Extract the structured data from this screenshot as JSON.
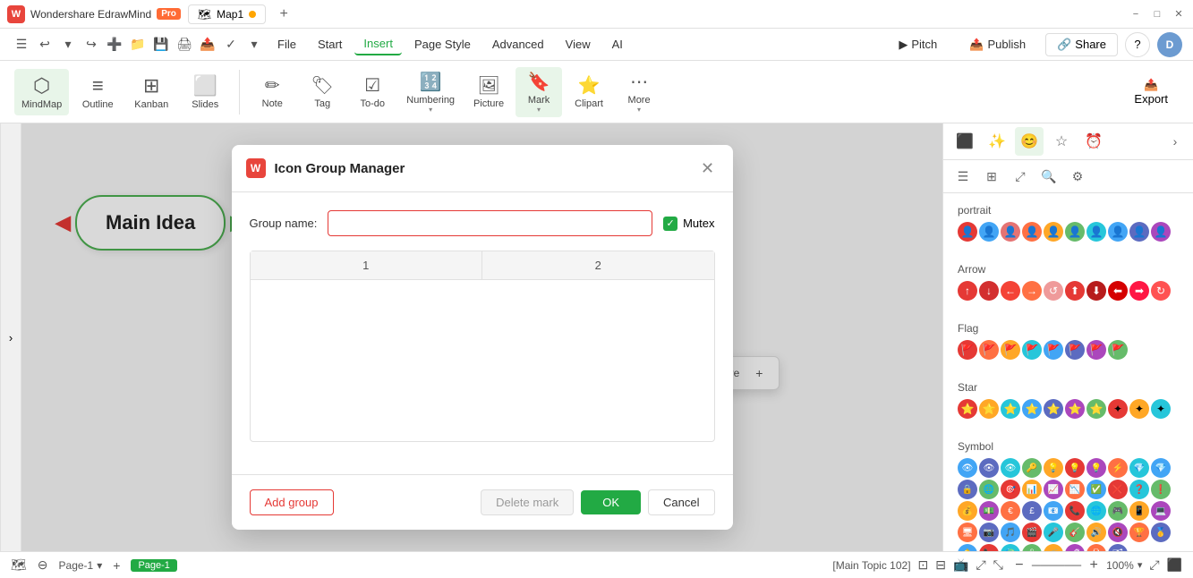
{
  "app": {
    "name": "Wondershare EdrawMind",
    "badge": "Pro",
    "tab": "Map1",
    "user_initial": "D"
  },
  "titlebar": {
    "minimize": "−",
    "maximize": "□",
    "close": "✕"
  },
  "quickaccess": {
    "undo": "↩",
    "redo": "↪"
  },
  "menu": {
    "items": [
      "File",
      "Start",
      "Insert",
      "Page Style",
      "Advanced",
      "View",
      "AI"
    ],
    "active": "Insert",
    "right": {
      "pitch": "Pitch",
      "publish": "Publish",
      "share": "Share",
      "help": "?",
      "user": "D"
    }
  },
  "toolbar": {
    "left_items": [
      {
        "id": "mindmap",
        "icon": "⬡",
        "label": "MindMap"
      },
      {
        "id": "outline",
        "icon": "≡",
        "label": "Outline"
      },
      {
        "id": "kanban",
        "icon": "⊞",
        "label": "Kanban"
      },
      {
        "id": "slides",
        "icon": "⬜",
        "label": "Slides"
      }
    ],
    "right_items": [
      {
        "id": "note",
        "icon": "✏",
        "label": "Note"
      },
      {
        "id": "tag",
        "icon": "🏷",
        "label": "Tag"
      },
      {
        "id": "todo",
        "icon": "☑",
        "label": "To-do"
      },
      {
        "id": "numbering",
        "icon": "≡",
        "label": "Numbering"
      },
      {
        "id": "picture",
        "icon": "🖼",
        "label": "Picture"
      },
      {
        "id": "mark",
        "icon": "🔖",
        "label": "Mark",
        "active": true
      },
      {
        "id": "clipart",
        "icon": "⭐",
        "label": "Clipart"
      },
      {
        "id": "more",
        "icon": "⋯",
        "label": "More"
      }
    ],
    "export": "Export"
  },
  "dialog": {
    "title": "Icon Group Manager",
    "logo": "W",
    "field": {
      "label": "Group name:",
      "placeholder": ""
    },
    "mutex": {
      "label": "Mutex",
      "checked": true
    },
    "table_headers": [
      "1",
      "2"
    ],
    "buttons": {
      "add_group": "Add group",
      "delete_mark": "Delete mark",
      "ok": "OK",
      "cancel": "Cancel"
    }
  },
  "canvas": {
    "main_idea": "Main Idea"
  },
  "float_toolbar": {
    "more_icon": "⋯",
    "more_label": "More",
    "expand": "+"
  },
  "right_panel": {
    "sections": {
      "portrait": {
        "label": "portrait",
        "colors": [
          "#e53935",
          "#e57373",
          "#ff7043",
          "#ffa726",
          "#ffee58",
          "#66bb6a",
          "#26c6da",
          "#42a5f5",
          "#5c6bc0",
          "#ab47bc"
        ]
      },
      "arrow": {
        "label": "Arrow",
        "colors": [
          "#e53935",
          "#d32f2f",
          "#c62828",
          "#e57373",
          "#ef9a9a",
          "#e53935",
          "#b71c1c",
          "#d50000",
          "#ff1744",
          "#ff5252"
        ]
      },
      "flag": {
        "label": "Flag",
        "colors": [
          "#e53935",
          "#ff7043",
          "#ffa726",
          "#26c6da",
          "#42a5f5",
          "#5c6bc0",
          "#ab47bc",
          "#66bb6a"
        ]
      },
      "star": {
        "label": "Star",
        "colors": [
          "#e53935",
          "#ffa726",
          "#26c6da",
          "#42a5f5",
          "#5c6bc0",
          "#ab47bc",
          "#66bb6a",
          "#e53935",
          "#ffa726",
          "#26c6da"
        ]
      },
      "symbol": {
        "label": "Symbol",
        "colors": [
          "#42a5f5",
          "#5c6bc0",
          "#26c6da",
          "#66bb6a",
          "#ffa726",
          "#e53935",
          "#ab47bc",
          "#ff7043",
          "#26c6da",
          "#42a5f5",
          "#5c6bc0",
          "#66bb6a",
          "#e53935",
          "#ffa726",
          "#ab47bc",
          "#ff7043",
          "#42a5f5",
          "#e53935",
          "#26c6da",
          "#66bb6a",
          "#ffa726",
          "#ab47bc",
          "#ff7043",
          "#5c6bc0",
          "#42a5f5",
          "#e53935",
          "#26c6da",
          "#66bb6a",
          "#ffa726",
          "#ab47bc",
          "#ff7043",
          "#5c6bc0",
          "#42a5f5",
          "#e53935",
          "#26c6da",
          "#66bb6a",
          "#ffa726",
          "#ab47bc",
          "#ff7043",
          "#5c6bc0",
          "#42a5f5",
          "#e53935",
          "#26c6da",
          "#66bb6a",
          "#ffa726",
          "#ab47bc",
          "#ff7043",
          "#5c6bc0"
        ]
      }
    }
  },
  "status_bar": {
    "page_indicator": "Page-1",
    "current_page": "Page-1",
    "node_info": "[Main Topic 102]",
    "zoom": "100%",
    "zoom_minus": "−",
    "zoom_plus": "+"
  }
}
